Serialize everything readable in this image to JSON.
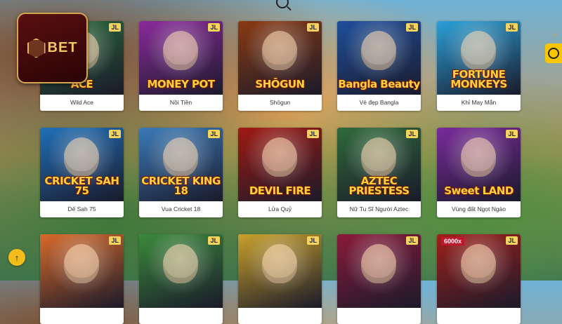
{
  "brand": {
    "logo_text": "BET"
  },
  "provider_badge": "JL",
  "games": [
    {
      "label": "Wild Ace",
      "art": "ACE",
      "bg": "#2b6a3a"
    },
    {
      "label": "Nồi Tiền",
      "art": "MONEY POT",
      "bg": "#8a2a9a"
    },
    {
      "label": "Shōgun",
      "art": "SHŌGUN",
      "bg": "#8a3a12"
    },
    {
      "label": "Vẻ đẹp Bangla",
      "art": "Bangla Beauty",
      "bg": "#1f4f9a"
    },
    {
      "label": "Khỉ May Mắn",
      "art": "FORTUNE MONKEYS",
      "bg": "#2aa0d8"
    },
    {
      "label": "Dế Sah 75",
      "art": "CRICKET SAH 75",
      "bg": "#1f6fb8"
    },
    {
      "label": "Vua Cricket 18",
      "art": "CRICKET KING 18",
      "bg": "#3a7ab8"
    },
    {
      "label": "Lửa Quỷ",
      "art": "DEVIL FIRE",
      "bg": "#a01a12"
    },
    {
      "label": "Nữ Tu Sĩ Người Aztec",
      "art": "AZTEC PRIESTESS",
      "bg": "#2f6a3a"
    },
    {
      "label": "Vùng đất Ngọt Ngào",
      "art": "Sweet LAND",
      "bg": "#7a2a9a"
    },
    {
      "label": "",
      "art": "",
      "bg": "#d86a2a"
    },
    {
      "label": "",
      "art": "",
      "bg": "#3a8a3a"
    },
    {
      "label": "",
      "art": "",
      "bg": "#c9a02a"
    },
    {
      "label": "",
      "art": "",
      "bg": "#8a1a3a"
    },
    {
      "label": "",
      "art": "",
      "bg": "#a0201a",
      "multiplier": "6000x"
    }
  ],
  "controls": {
    "scroll_top_glyph": "↑",
    "side_arrow_glyph": "↓"
  }
}
